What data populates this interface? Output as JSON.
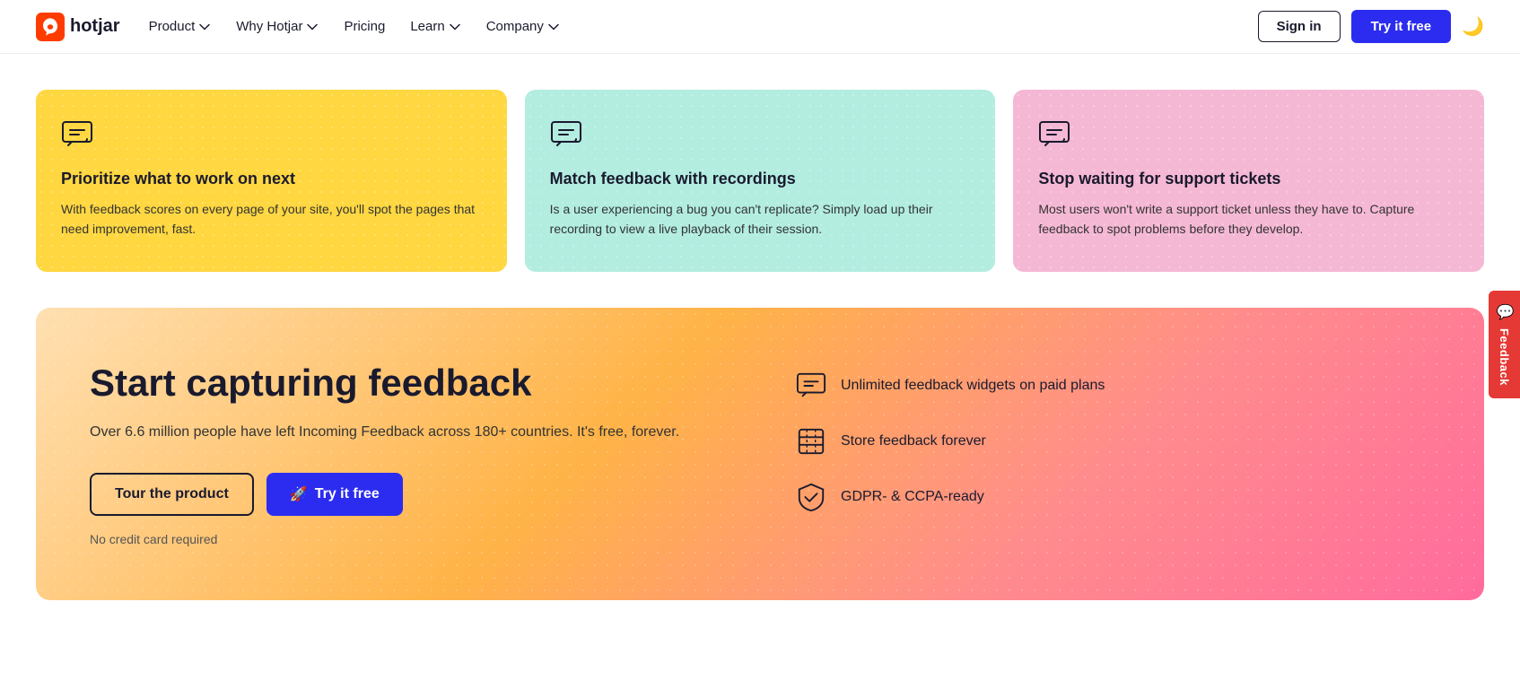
{
  "brand": {
    "name": "hotjar",
    "logo_text": "hotjar"
  },
  "nav": {
    "items": [
      {
        "id": "product",
        "label": "Product",
        "has_dropdown": true
      },
      {
        "id": "why-hotjar",
        "label": "Why Hotjar",
        "has_dropdown": true
      },
      {
        "id": "pricing",
        "label": "Pricing",
        "has_dropdown": false
      },
      {
        "id": "learn",
        "label": "Learn",
        "has_dropdown": true
      },
      {
        "id": "company",
        "label": "Company",
        "has_dropdown": true
      }
    ],
    "sign_in_label": "Sign in",
    "try_free_label": "Try it free"
  },
  "cards": [
    {
      "id": "card-yellow",
      "title": "Prioritize what to work on next",
      "description": "With feedback scores on every page of your site, you'll spot the pages that need improvement, fast.",
      "color": "yellow"
    },
    {
      "id": "card-teal",
      "title": "Match feedback with recordings",
      "description": "Is a user experiencing a bug you can't replicate? Simply load up their recording to view a live playback of their session.",
      "color": "teal"
    },
    {
      "id": "card-pink",
      "title": "Stop waiting for support tickets",
      "description": "Most users won't write a support ticket unless they have to. Capture feedback to spot problems before they develop.",
      "color": "pink"
    }
  ],
  "cta": {
    "title": "Start capturing feedback",
    "description": "Over 6.6 million people have left Incoming Feedback across 180+ countries. It's free, forever.",
    "tour_label": "Tour the product",
    "try_label": "Try it free",
    "note": "No credit card required",
    "features": [
      {
        "id": "unlimited-widgets",
        "text": "Unlimited feedback widgets on paid plans"
      },
      {
        "id": "store-feedback",
        "text": "Store feedback forever"
      },
      {
        "id": "gdpr",
        "text": "GDPR- & CCPA-ready"
      }
    ]
  },
  "feedback_tab": {
    "label": "Feedback"
  }
}
